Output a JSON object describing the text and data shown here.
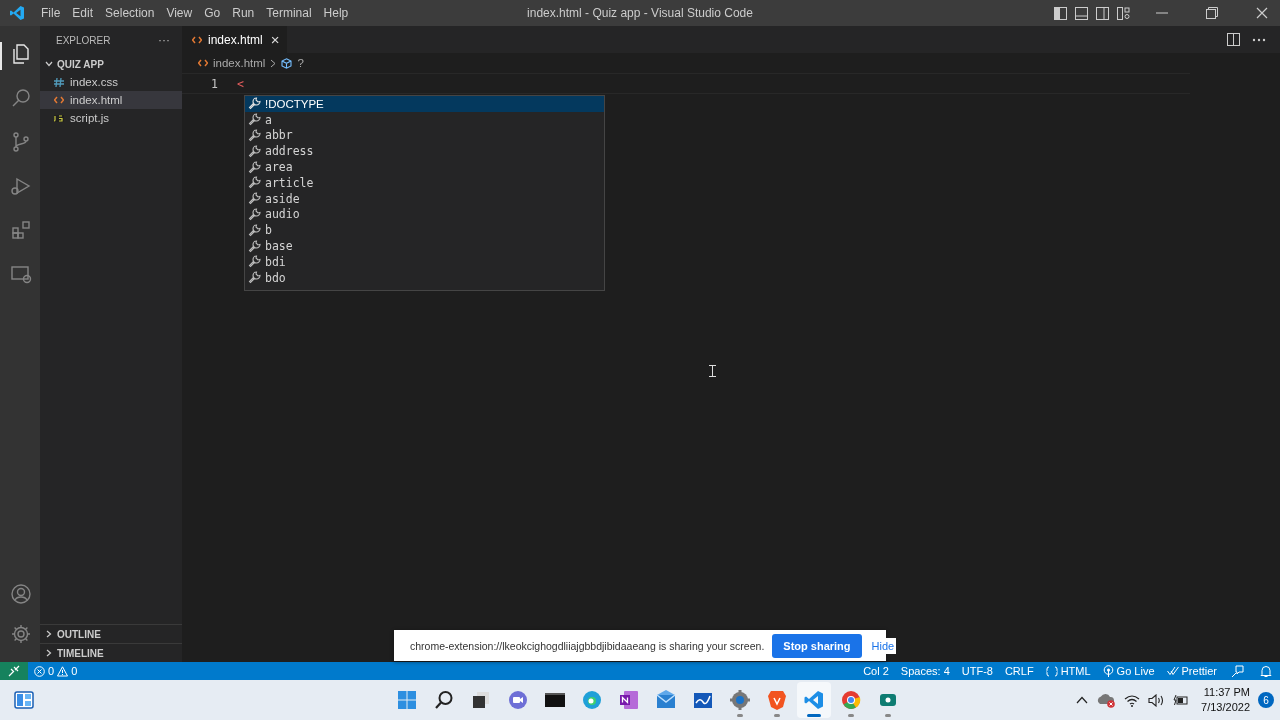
{
  "menu": [
    "File",
    "Edit",
    "Selection",
    "View",
    "Go",
    "Run",
    "Terminal",
    "Help"
  ],
  "window": {
    "title": "index.html - Quiz app - Visual Studio Code"
  },
  "activity_bar": {
    "top": [
      {
        "selected": true
      },
      {
        "selected": false
      },
      {
        "selected": false
      },
      {
        "selected": false
      },
      {
        "selected": false
      },
      {
        "selected": false
      }
    ]
  },
  "sidebar": {
    "title": "EXPLORER",
    "more": "···",
    "folder": {
      "name": "QUIZ APP",
      "expanded": true,
      "files": [
        {
          "name": "index.css",
          "kind": "css",
          "selected": false
        },
        {
          "name": "index.html",
          "kind": "html",
          "selected": true
        },
        {
          "name": "script.js",
          "kind": "js",
          "selected": false
        }
      ]
    },
    "sections": [
      {
        "name": "OUTLINE",
        "expanded": false
      },
      {
        "name": "TIMELINE",
        "expanded": false
      }
    ]
  },
  "tabs": [
    {
      "label": "index.html",
      "selected": true,
      "close": "×"
    }
  ],
  "breadcrumbs": {
    "file": "index.html",
    "symbol": "?"
  },
  "editor": {
    "lines": [
      {
        "number": "1",
        "text": "<"
      }
    ]
  },
  "suggestions": [
    {
      "label": "!DOCTYPE",
      "selected": true
    },
    {
      "label": "a",
      "selected": false
    },
    {
      "label": "abbr",
      "selected": false
    },
    {
      "label": "address",
      "selected": false
    },
    {
      "label": "area",
      "selected": false
    },
    {
      "label": "article",
      "selected": false
    },
    {
      "label": "aside",
      "selected": false
    },
    {
      "label": "audio",
      "selected": false
    },
    {
      "label": "b",
      "selected": false
    },
    {
      "label": "base",
      "selected": false
    },
    {
      "label": "bdi",
      "selected": false
    },
    {
      "label": "bdo",
      "selected": false
    }
  ],
  "status_bar": {
    "errors": "0",
    "warnings": "0",
    "right": [
      "Col 2",
      "Spaces: 4",
      "UTF-8",
      "CRLF",
      "HTML",
      "Go Live",
      "Prettier"
    ]
  },
  "share_banner": {
    "message": "chrome-extension://lkeokcighogdliiajgbbdjibidaaeang is sharing your screen.",
    "stop": "Stop sharing",
    "hide": "Hide"
  },
  "taskbar": {
    "apps": [
      {
        "running": false,
        "active": false
      },
      {
        "running": false,
        "active": false
      },
      {
        "running": false,
        "active": false
      },
      {
        "running": false,
        "active": false
      },
      {
        "running": false,
        "active": false
      },
      {
        "running": false,
        "active": false
      },
      {
        "running": false,
        "active": false
      },
      {
        "running": false,
        "active": false
      },
      {
        "running": false,
        "active": false
      },
      {
        "running": true,
        "active": false
      },
      {
        "running": true,
        "active": false
      },
      {
        "running": true,
        "active": true
      },
      {
        "running": true,
        "active": false
      },
      {
        "running": true,
        "active": false
      }
    ],
    "time": "11:37 PM",
    "date": "7/13/2022",
    "notifications": "6"
  }
}
